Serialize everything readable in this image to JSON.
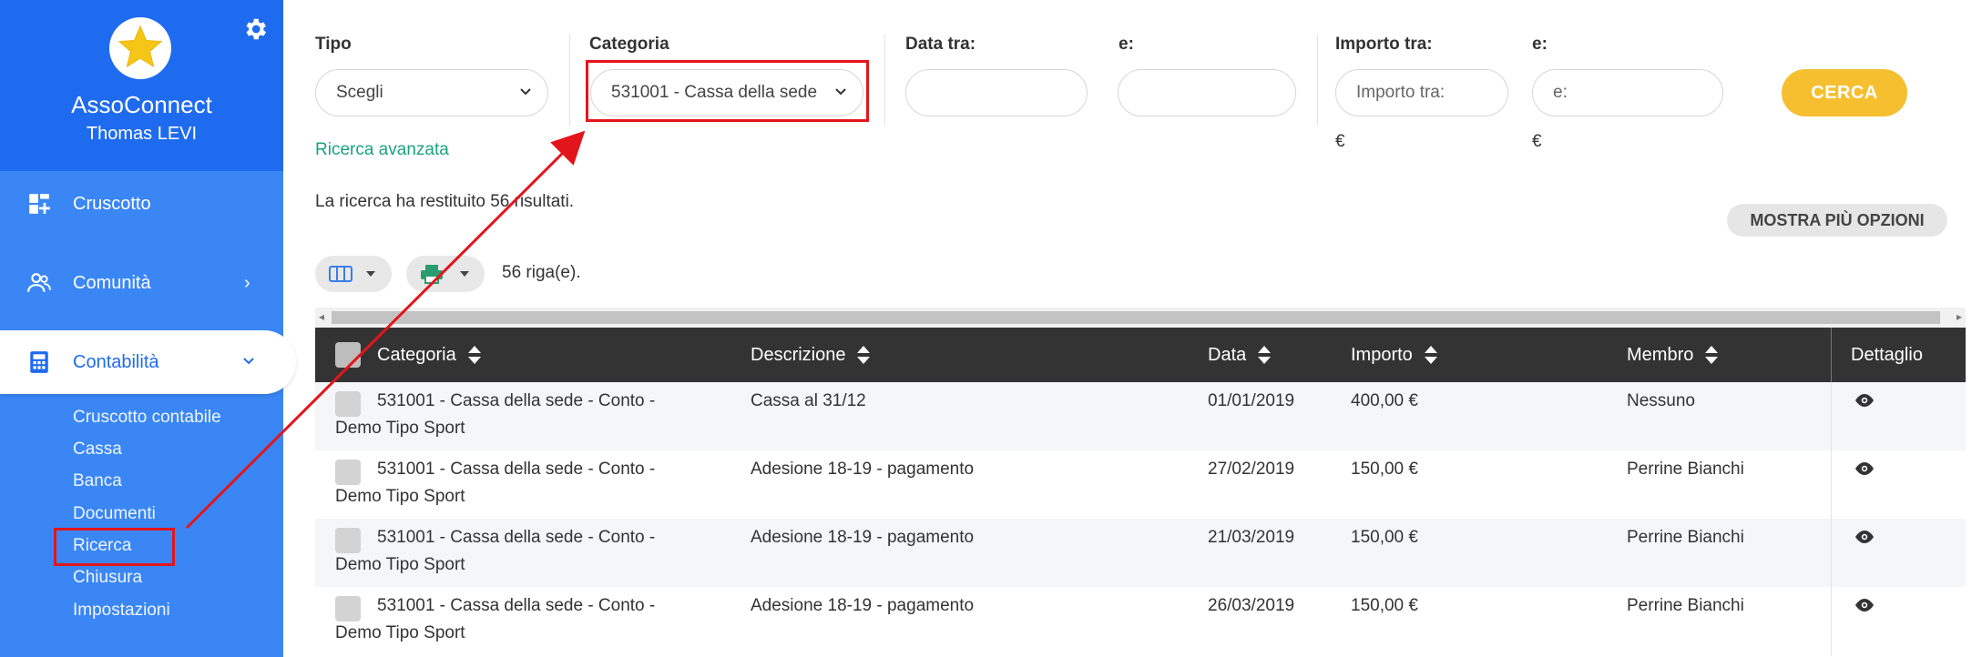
{
  "sidebar": {
    "brand": "AssoConnect",
    "user": "Thomas LEVI",
    "nav": [
      {
        "label": "Cruscotto",
        "icon": "dashboard-icon"
      },
      {
        "label": "Comunità",
        "icon": "users-icon"
      },
      {
        "label": "Contabilità",
        "icon": "calculator-icon"
      }
    ],
    "sub": [
      "Cruscotto contabile",
      "Cassa",
      "Banca",
      "Documenti",
      "Ricerca",
      "Chiusura",
      "Impostazioni"
    ]
  },
  "filters": {
    "tipo_label": "Tipo",
    "tipo_value": "Scegli",
    "categoria_label": "Categoria",
    "categoria_value": "531001 - Cassa della sede",
    "data_tra_label": "Data tra:",
    "data_e_label": "e:",
    "importo_tra_label": "Importo tra:",
    "importo_tra_placeholder": "Importo tra:",
    "importo_e_label": "e:",
    "importo_e_placeholder": "e:",
    "currency": "€",
    "search_button": "CERCA",
    "advanced_link": "Ricerca avanzata",
    "results_text": "La ricerca ha restituito 56 risultati.",
    "more_options": "MOSTRA PIÙ OPZIONI"
  },
  "toolbar": {
    "row_count": "56 riga(e)."
  },
  "table": {
    "columns": [
      "Categoria",
      "Descrizione",
      "Data",
      "Importo",
      "Membro",
      "Dettaglio"
    ],
    "rows": [
      {
        "categoria_1": "531001 - Cassa della sede - Conto -",
        "categoria_2": "Demo Tipo Sport",
        "descrizione": "Cassa al 31/12",
        "data": "01/01/2019",
        "importo": "400,00 €",
        "membro": "Nessuno"
      },
      {
        "categoria_1": "531001 - Cassa della sede - Conto -",
        "categoria_2": "Demo Tipo Sport",
        "descrizione": "Adesione 18-19 - pagamento",
        "data": "27/02/2019",
        "importo": "150,00 €",
        "membro": "Perrine Bianchi"
      },
      {
        "categoria_1": "531001 - Cassa della sede - Conto -",
        "categoria_2": "Demo Tipo Sport",
        "descrizione": "Adesione 18-19 - pagamento",
        "data": "21/03/2019",
        "importo": "150,00 €",
        "membro": "Perrine Bianchi"
      },
      {
        "categoria_1": "531001 - Cassa della sede - Conto -",
        "categoria_2": "Demo Tipo Sport",
        "descrizione": "Adesione 18-19 - pagamento",
        "data": "26/03/2019",
        "importo": "150,00 €",
        "membro": "Perrine Bianchi"
      }
    ]
  },
  "colors": {
    "sidebar": "#3a86f5",
    "sidebar_header": "#1f6bef",
    "accent_button": "#f5bf30",
    "link": "#1aa37f",
    "annotation": "#e3151b"
  }
}
